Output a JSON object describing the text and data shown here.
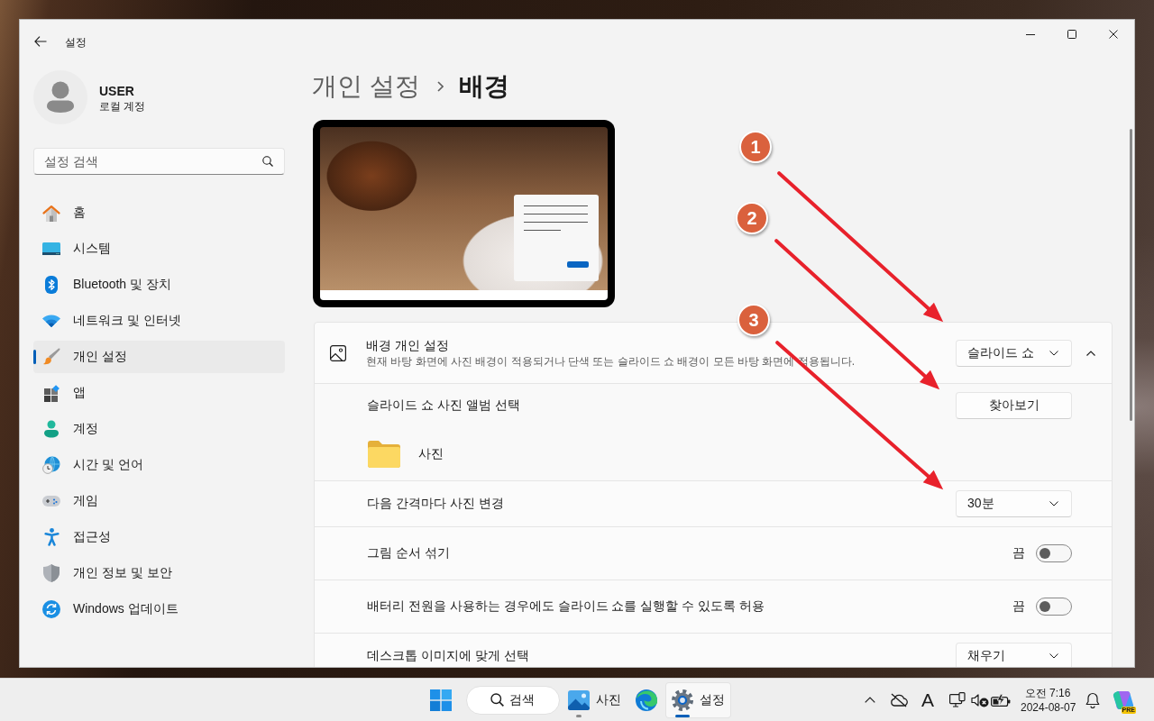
{
  "window": {
    "title": "설정"
  },
  "user": {
    "name": "USER",
    "account": "로컬 계정"
  },
  "search": {
    "placeholder": "설정 검색"
  },
  "nav": [
    {
      "label": "홈",
      "selected": false
    },
    {
      "label": "시스템",
      "selected": false
    },
    {
      "label": "Bluetooth 및 장치",
      "selected": false
    },
    {
      "label": "네트워크 및 인터넷",
      "selected": false
    },
    {
      "label": "개인 설정",
      "selected": true
    },
    {
      "label": "앱",
      "selected": false
    },
    {
      "label": "계정",
      "selected": false
    },
    {
      "label": "시간 및 언어",
      "selected": false
    },
    {
      "label": "게임",
      "selected": false
    },
    {
      "label": "접근성",
      "selected": false
    },
    {
      "label": "개인 정보 및 보안",
      "selected": false
    },
    {
      "label": "Windows 업데이트",
      "selected": false
    }
  ],
  "breadcrumb": {
    "parent": "개인 설정",
    "current": "배경"
  },
  "background": {
    "title": "배경 개인 설정",
    "description": "현재 바탕 화면에 사진 배경이 적용되거나 단색 또는 슬라이드 쇼 배경이 모든 바탕 화면에 적용됩니다.",
    "value": "슬라이드 쇼",
    "expanded": true,
    "album": {
      "label": "슬라이드 쇼 사진 앨범 선택",
      "button": "찾아보기",
      "folder": "사진"
    }
  },
  "settings": [
    {
      "kind": "dropdown",
      "label": "다음 간격마다 사진 변경",
      "value": "30분"
    },
    {
      "kind": "toggle",
      "label": "그림 순서 섞기",
      "state_label": "끔",
      "on": false
    },
    {
      "kind": "toggle",
      "label": "배터리 전원을 사용하는 경우에도 슬라이드 쇼를 실행할 수 있도록 허용",
      "state_label": "끔",
      "on": false
    },
    {
      "kind": "dropdown",
      "label": "데스크톱 이미지에 맞게 선택",
      "value": "채우기"
    }
  ],
  "annotations": [
    {
      "label": "1"
    },
    {
      "label": "2"
    },
    {
      "label": "3"
    }
  ],
  "taskbar": {
    "search": "검색",
    "apps": [
      {
        "label": "사진",
        "running": true,
        "selected": false
      },
      {
        "running": false,
        "selected": false
      },
      {
        "label": "설정",
        "running": true,
        "selected": true
      }
    ],
    "tray": {
      "ime": "A",
      "time": "오전 7:16",
      "date": "2024-08-07",
      "badge": "PRE"
    }
  }
}
